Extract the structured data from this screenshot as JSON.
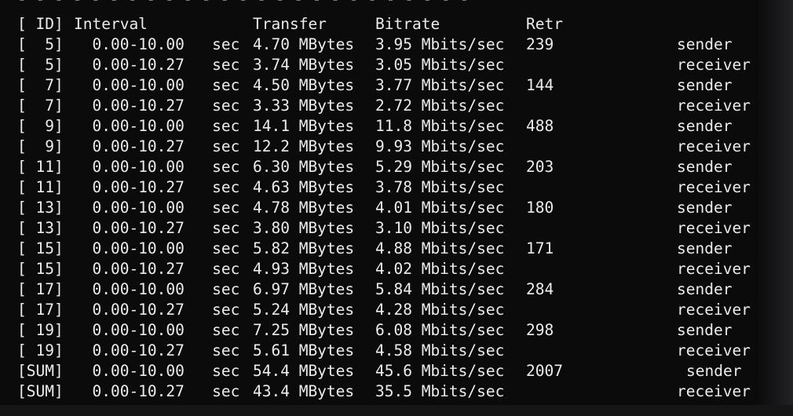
{
  "terminal": {
    "separator": "- - - - - - - - - - - - - - - - - - - - - - - - -",
    "header": {
      "id": "[ ID]",
      "interval": "Interval",
      "transfer": "Transfer",
      "bitrate": "Bitrate",
      "retr": "Retr"
    },
    "rows": [
      {
        "id": "[  5]",
        "interval": "  0.00-10.00   sec",
        "transfer": "4.70 MBytes",
        "bitrate": "3.95 Mbits/sec",
        "retr": "239",
        "role": "sender"
      },
      {
        "id": "[  5]",
        "interval": "  0.00-10.27   sec",
        "transfer": "3.74 MBytes",
        "bitrate": "3.05 Mbits/sec",
        "retr": "",
        "role": "receiver"
      },
      {
        "id": "[  7]",
        "interval": "  0.00-10.00   sec",
        "transfer": "4.50 MBytes",
        "bitrate": "3.77 Mbits/sec",
        "retr": "144",
        "role": "sender"
      },
      {
        "id": "[  7]",
        "interval": "  0.00-10.27   sec",
        "transfer": "3.33 MBytes",
        "bitrate": "2.72 Mbits/sec",
        "retr": "",
        "role": "receiver"
      },
      {
        "id": "[  9]",
        "interval": "  0.00-10.00   sec",
        "transfer": "14.1 MBytes",
        "bitrate": "11.8 Mbits/sec",
        "retr": "488",
        "role": "sender"
      },
      {
        "id": "[  9]",
        "interval": "  0.00-10.27   sec",
        "transfer": "12.2 MBytes",
        "bitrate": "9.93 Mbits/sec",
        "retr": "",
        "role": "receiver"
      },
      {
        "id": "[ 11]",
        "interval": "  0.00-10.00   sec",
        "transfer": "6.30 MBytes",
        "bitrate": "5.29 Mbits/sec",
        "retr": "203",
        "role": "sender"
      },
      {
        "id": "[ 11]",
        "interval": "  0.00-10.27   sec",
        "transfer": "4.63 MBytes",
        "bitrate": "3.78 Mbits/sec",
        "retr": "",
        "role": "receiver"
      },
      {
        "id": "[ 13]",
        "interval": "  0.00-10.00   sec",
        "transfer": "4.78 MBytes",
        "bitrate": "4.01 Mbits/sec",
        "retr": "180",
        "role": "sender"
      },
      {
        "id": "[ 13]",
        "interval": "  0.00-10.27   sec",
        "transfer": "3.80 MBytes",
        "bitrate": "3.10 Mbits/sec",
        "retr": "",
        "role": "receiver"
      },
      {
        "id": "[ 15]",
        "interval": "  0.00-10.00   sec",
        "transfer": "5.82 MBytes",
        "bitrate": "4.88 Mbits/sec",
        "retr": "171",
        "role": "sender"
      },
      {
        "id": "[ 15]",
        "interval": "  0.00-10.27   sec",
        "transfer": "4.93 MBytes",
        "bitrate": "4.02 Mbits/sec",
        "retr": "",
        "role": "receiver"
      },
      {
        "id": "[ 17]",
        "interval": "  0.00-10.00   sec",
        "transfer": "6.97 MBytes",
        "bitrate": "5.84 Mbits/sec",
        "retr": "284",
        "role": "sender"
      },
      {
        "id": "[ 17]",
        "interval": "  0.00-10.27   sec",
        "transfer": "5.24 MBytes",
        "bitrate": "4.28 Mbits/sec",
        "retr": "",
        "role": "receiver"
      },
      {
        "id": "[ 19]",
        "interval": "  0.00-10.00   sec",
        "transfer": "7.25 MBytes",
        "bitrate": "6.08 Mbits/sec",
        "retr": "298",
        "role": "sender"
      },
      {
        "id": "[ 19]",
        "interval": "  0.00-10.27   sec",
        "transfer": "5.61 MBytes",
        "bitrate": "4.58 Mbits/sec",
        "retr": "",
        "role": "receiver"
      },
      {
        "id": "[SUM]",
        "interval": "  0.00-10.00   sec",
        "transfer": "54.4 MBytes",
        "bitrate": "45.6 Mbits/sec",
        "retr": "2007",
        "role": "sender"
      },
      {
        "id": "[SUM]",
        "interval": "  0.00-10.27   sec",
        "transfer": "43.4 MBytes",
        "bitrate": "35.5 Mbits/sec",
        "retr": "",
        "role": "receiver"
      }
    ]
  }
}
